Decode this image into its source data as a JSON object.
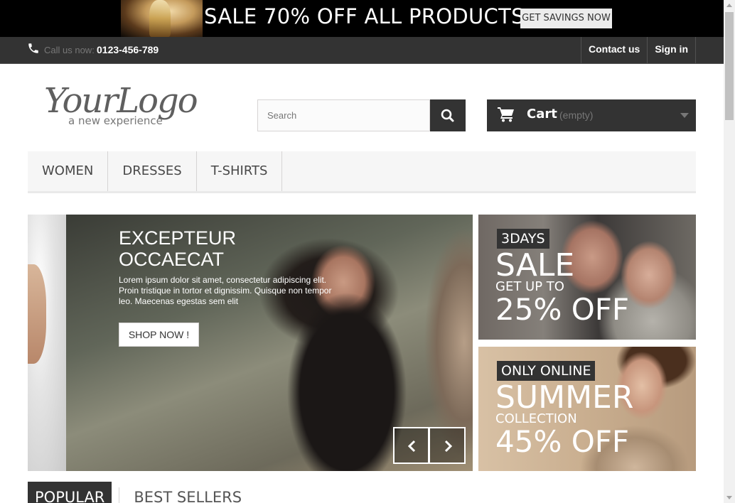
{
  "promo": {
    "text": "SALE 70% OFF ALL PRODUCTS",
    "button": "GET SAVINGS NOW"
  },
  "topbar": {
    "call_label": "Call us now:",
    "call_number": "0123-456-789",
    "nav": [
      "Contact us",
      "Sign in"
    ]
  },
  "header": {
    "logo": {
      "main": "YourLogo",
      "tagline": "a new experience"
    },
    "search_placeholder": "Search",
    "cart_label": "Cart",
    "cart_status": "(empty)"
  },
  "menu": [
    "WOMEN",
    "DRESSES",
    "T-SHIRTS"
  ],
  "slider": {
    "title_line1": "EXCEPTEUR",
    "title_line2": "OCCAECAT",
    "text": "Lorem ipsum dolor sit amet, consectetur adipiscing elit. Proin tristique in tortor et dignissim. Quisque non tempor leo. Maecenas egestas sem elit",
    "button": "SHOP NOW !"
  },
  "banners": [
    {
      "tag": "3DAYS",
      "headline": "SALE",
      "sub": "GET UP TO",
      "offer": "25% OFF"
    },
    {
      "tag": "ONLY ONLINE",
      "headline": "SUMMER",
      "sub": "COLLECTION",
      "offer": "45% OFF"
    }
  ],
  "tabs": [
    "POPULAR",
    "BEST SELLERS"
  ],
  "colors": {
    "dark": "#333333",
    "menu_bg": "#f6f6f6",
    "black_banner": "#000000"
  }
}
